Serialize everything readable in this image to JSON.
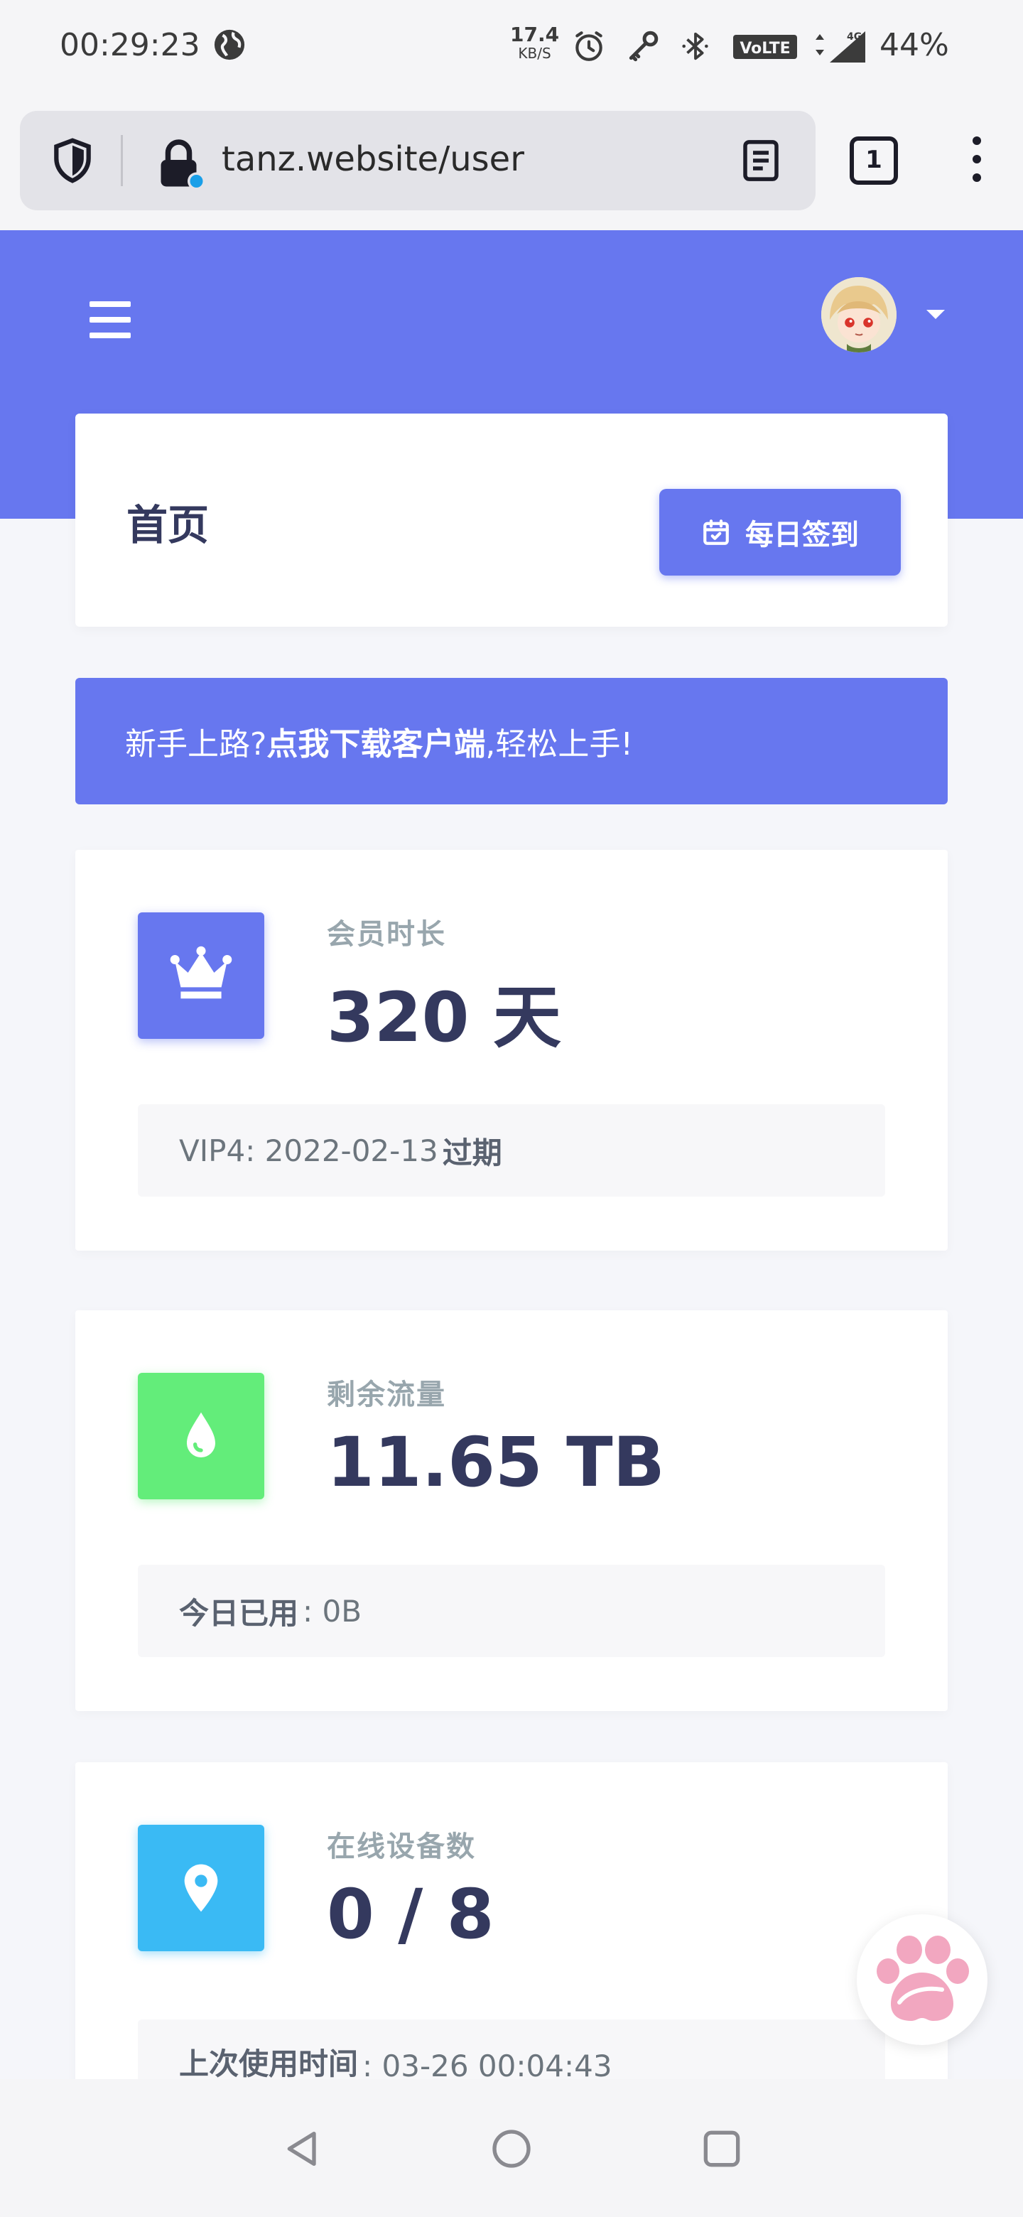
{
  "status_bar": {
    "time": "00:29:23",
    "net_speed_value": "17.4",
    "net_speed_unit": "KB/S",
    "battery": "44%",
    "icons": [
      "globe-icon",
      "alarm-icon",
      "key-icon",
      "bluetooth-icon",
      "volte-icon",
      "signal-4g-icon"
    ]
  },
  "browser": {
    "url": "tanz.website/user",
    "tab_count": "1"
  },
  "header": {
    "accent_color": "#6777ef"
  },
  "page": {
    "title": "首页",
    "checkin_label": "每日签到"
  },
  "alert": {
    "prefix": "新手上路?",
    "link_text": "点我下载客户端",
    "suffix": ",轻松上手!"
  },
  "stats": [
    {
      "label": "会员时长",
      "value": "320 天",
      "icon": "crown-icon",
      "color": "#6777ef",
      "foot_text": "VIP4: 2022-02-13",
      "foot_bold": "过期"
    },
    {
      "label": "剩余流量",
      "value": "11.65 TB",
      "icon": "droplet-icon",
      "color": "#63ed7a",
      "foot_bold": "今日已用",
      "foot_text": ": 0B"
    },
    {
      "label": "在线设备数",
      "value": "0 / 8",
      "icon": "map-pin-icon",
      "color": "#3abaf4",
      "foot_bold": "上次使用时间",
      "foot_text": ": 03-26 00:04:43"
    }
  ]
}
